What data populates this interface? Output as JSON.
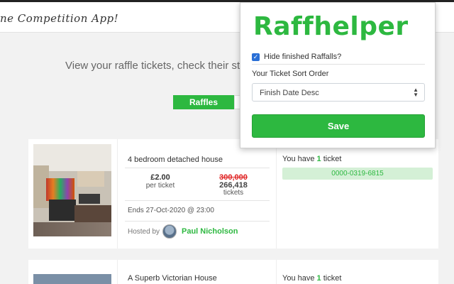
{
  "header": {
    "app_title": "ne Competition App!"
  },
  "page": {
    "tagline": "View your raffle tickets, check their status"
  },
  "tabs": {
    "raffles_label": "Raffles"
  },
  "cards": [
    {
      "title": "4 bedroom detached house",
      "price": "£2.00",
      "price_sub": "per ticket",
      "original_tickets": "300,000",
      "remaining_tickets": "266,418",
      "tickets_label": "tickets",
      "ends": "Ends 27-Oct-2020 @ 23:00",
      "hosted_by_label": "Hosted by",
      "host_name": "Paul Nicholson",
      "you_have_prefix": "You have",
      "ticket_count": "1",
      "ticket_word": "ticket",
      "ticket_numbers": [
        "0000-0319-6815"
      ]
    },
    {
      "title": "A Superb Victorian House",
      "you_have_prefix": "You have",
      "ticket_count": "1",
      "ticket_word": "ticket"
    }
  ],
  "popup": {
    "logo": "Raffhelper",
    "hide_finished_label": "Hide finished Raffalls?",
    "hide_finished_checked": true,
    "sort_label": "Your Ticket Sort Order",
    "sort_value": "Finish Date Desc",
    "save_label": "Save"
  },
  "colors": {
    "accent": "#2db840",
    "strike": "#e02424",
    "ticket_pill_bg": "#d4f0d6",
    "checkbox": "#2a6fd6"
  }
}
